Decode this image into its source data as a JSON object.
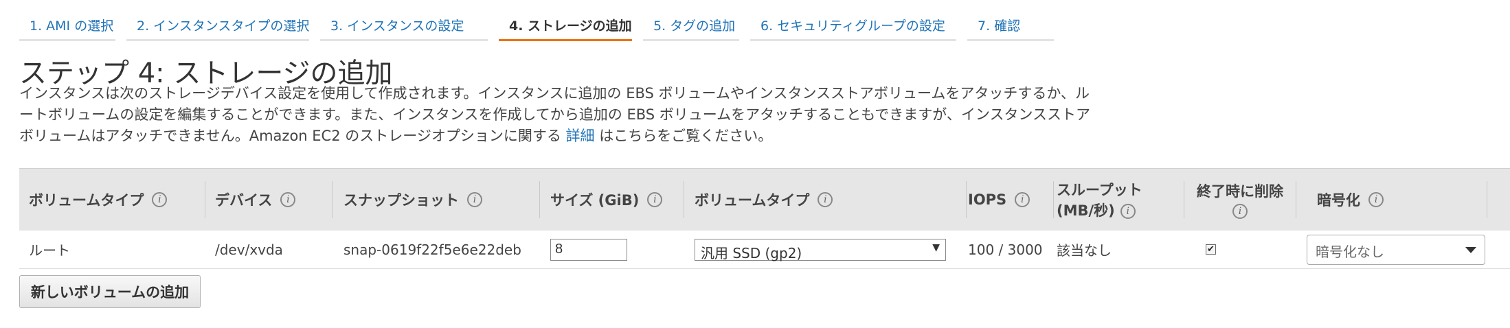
{
  "steps": [
    {
      "label": "1. AMI の選択"
    },
    {
      "label": "2. インスタンスタイプの選択"
    },
    {
      "label": "3. インスタンスの設定"
    },
    {
      "label": "4. ストレージの追加"
    },
    {
      "label": "5. タグの追加"
    },
    {
      "label": "6. セキュリティグループの設定"
    },
    {
      "label": "7. 確認"
    }
  ],
  "active_step": 4,
  "page": {
    "title": "ステップ 4: ストレージの追加",
    "description_part1": "インスタンスは次のストレージデバイス設定を使用して作成されます。インスタンスに追加の EBS ボリュームやインスタンスストアボリュームをアタッチするか、ルートボリュームの設定を編集することができます。また、インスタンスを作成してから追加の EBS ボリュームをアタッチすることもできますが、インスタンスストアボリュームはアタッチできません。Amazon EC2 のストレージオプションに関する ",
    "description_link": "詳細",
    "description_part2": " はこちらをご覧ください。"
  },
  "table": {
    "headers": {
      "volume_type": "ボリュームタイプ",
      "device": "デバイス",
      "snapshot": "スナップショット",
      "size": "サイズ (GiB)",
      "ebs_type": "ボリュームタイプ",
      "iops": "IOPS",
      "throughput_line1": "スループット",
      "throughput_line2": "(MB/秒)",
      "delete_on_term": "終了時に削除",
      "encryption": "暗号化"
    },
    "rows": [
      {
        "volume_type": "ルート",
        "device": "/dev/xvda",
        "snapshot": "snap-0619f22f5e6e22deb",
        "size": "8",
        "ebs_type": "汎用 SSD (gp2)",
        "iops": "100 / 3000",
        "throughput": "該当なし",
        "delete_on_term": true,
        "encryption": "暗号化なし"
      }
    ]
  },
  "add_volume_button": "新しいボリュームの追加",
  "icons": {
    "info": "i",
    "checkbox_checked": "✔",
    "select_arrow": "▼"
  },
  "colors": {
    "link": "#1f73b7",
    "active_tab_underline": "#ec7211",
    "header_bg": "#e6e6e6"
  }
}
